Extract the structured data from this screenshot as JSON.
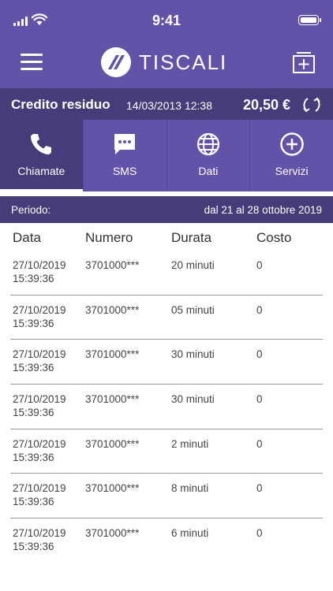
{
  "status_bar": {
    "time": "9:41"
  },
  "header": {
    "brand": "TISCALI"
  },
  "credit": {
    "label": "Credito residuo",
    "date": "14/03/2013 12:38",
    "amount": "20,50 €"
  },
  "tabs": [
    {
      "label": "Chiamate",
      "icon": "phone-icon",
      "active": true
    },
    {
      "label": "SMS",
      "icon": "message-icon",
      "active": false
    },
    {
      "label": "Dati",
      "icon": "globe-icon",
      "active": false
    },
    {
      "label": "Servizi",
      "icon": "plus-circle-icon",
      "active": false
    }
  ],
  "period": {
    "label": "Periodo:",
    "value": "dal 21 al 28 ottobre 2019"
  },
  "table": {
    "columns": [
      "Data",
      "Numero",
      "Durata",
      "Costo"
    ],
    "rows": [
      {
        "date": "27/10/2019",
        "time": "15:39:36",
        "number": "3701000***",
        "duration": "20 minuti",
        "cost": "0"
      },
      {
        "date": "27/10/2019",
        "time": "15:39:36",
        "number": "3701000***",
        "duration": "05 minuti",
        "cost": "0"
      },
      {
        "date": "27/10/2019",
        "time": "15:39:36",
        "number": "3701000***",
        "duration": "30 minuti",
        "cost": "0"
      },
      {
        "date": "27/10/2019",
        "time": "15:39:36",
        "number": "3701000***",
        "duration": "30 minuti",
        "cost": "0"
      },
      {
        "date": "27/10/2019",
        "time": "15:39:36",
        "number": "3701000***",
        "duration": "2 minuti",
        "cost": "0"
      },
      {
        "date": "27/10/2019",
        "time": "15:39:36",
        "number": "3701000***",
        "duration": "8 minuti",
        "cost": "0"
      },
      {
        "date": "27/10/2019",
        "time": "15:39:36",
        "number": "3701000***",
        "duration": "6 minuti",
        "cost": "0"
      }
    ]
  },
  "colors": {
    "primary": "#6253a8",
    "dark": "#463c7a",
    "text": "#444444"
  }
}
